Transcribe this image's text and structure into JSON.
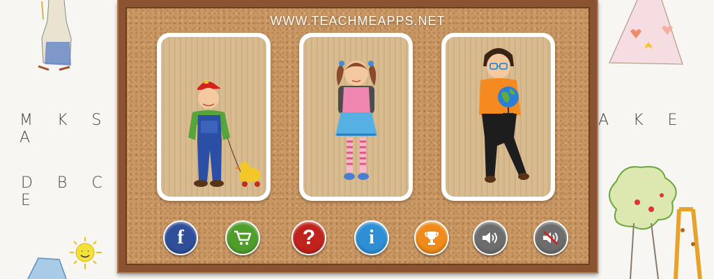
{
  "header": {
    "url_label": "WWW.TEACHMEAPPS.NET"
  },
  "cards": [
    {
      "name": "boy-with-toy-duck"
    },
    {
      "name": "girl-with-backpack"
    },
    {
      "name": "boy-with-globe"
    }
  ],
  "buttons": [
    {
      "icon": "facebook-icon",
      "glyph": "f",
      "color": "#2f4f9a"
    },
    {
      "icon": "cart-icon",
      "glyph": "",
      "color": "#4f9e2c"
    },
    {
      "icon": "question-icon",
      "glyph": "?",
      "color": "#c0221d"
    },
    {
      "icon": "info-icon",
      "glyph": "i",
      "color": "#2e8fd4"
    },
    {
      "icon": "trophy-icon",
      "glyph": "",
      "color": "#f08a1a"
    },
    {
      "icon": "sound-on-icon",
      "glyph": "",
      "color": "#6d6d6d"
    },
    {
      "icon": "sound-off-icon",
      "glyph": "",
      "color": "#6d6d6d"
    }
  ],
  "sketch": {
    "left_letters_top": "M K S A",
    "left_letters_bottom": "D B C E",
    "right_letters": "A K E"
  }
}
